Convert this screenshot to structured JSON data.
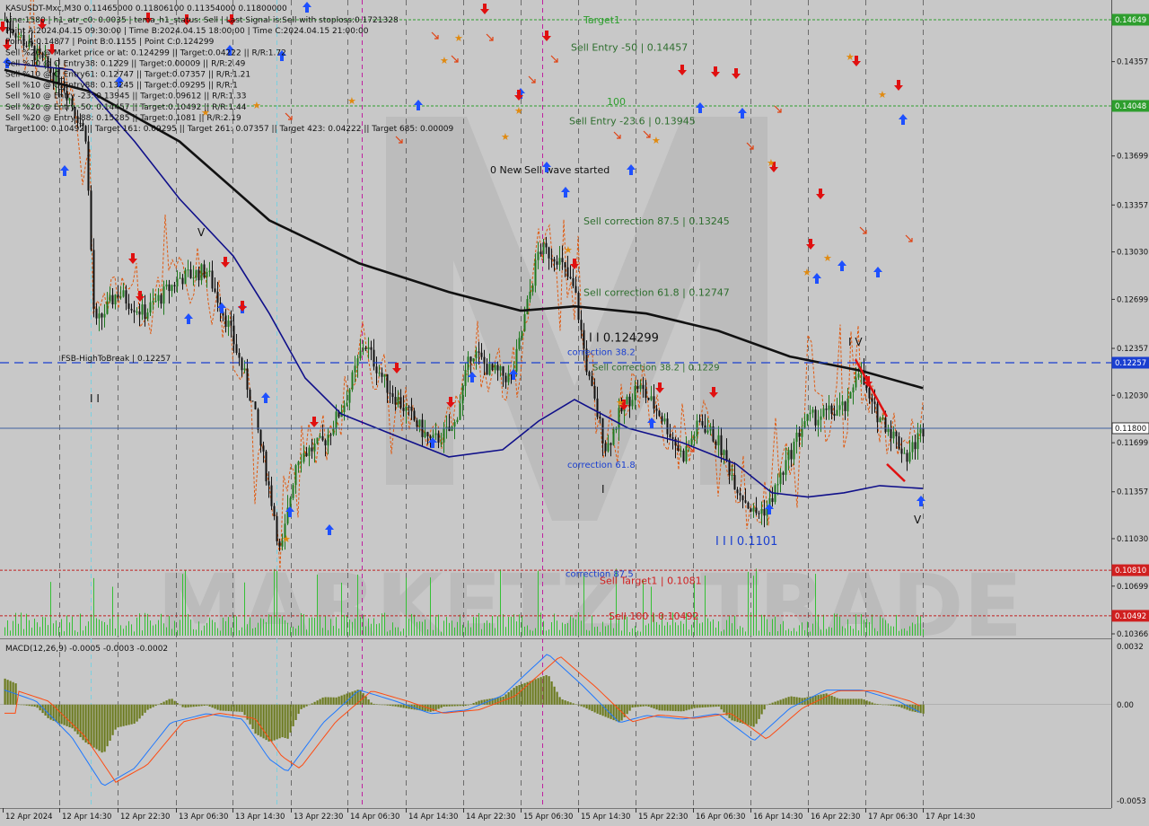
{
  "chart_data": {
    "type": "candlestick",
    "symbol": "KASUSDT-Mxc,M30",
    "header_values": "0.11465000 0.11806100 0.11354000 0.11800000",
    "info_lines": [
      "Line:1580 | h1_atr_c0: 0.0035 | tema_h1_status: Sell | Last Signal is:Sell with stoploss:0.1721328",
      "Point A:2024.04.15 09:30:00 | Time B:2024.04.15 18:00:00 | Time C:2024.04.15 21:00:00",
      "Point A:0.14877 | Point B:0.1155 | Point C:0.124299",
      "Sell %20 @ Market price or at: 0.124299 || Target:0.04222 || R/R:1.72",
      "Sell %10 @ C_Entry38: 0.1229 || Target:0.00009 || R/R:2.49",
      "Sell %10 @ C_Entry61: 0.12747 || Target:0.07357 || R/R:1.21",
      "Sell %10 @ C_Entry88: 0.13245 || Target:0.09295 || R/R:1",
      "Sell %10 @ Entry -23: 0.13945 || Target:0.09612 || R/R:1.33",
      "Sell %20 @ Entry -50: 0.14457 || Target:0.10492 || R/R:1.44",
      "Sell %20 @ Entry -88: 0.15285 || Target:0.1081 || R/R:2.19",
      "Target100: 0.10492 || Target 161: 0.09295 || Target 261: 0.07357 || Target 423: 0.04222 || Target 685: 0.00009"
    ],
    "price_axis": {
      "ylim": [
        0.10366,
        0.14699
      ],
      "ticks": [
        "0.14699",
        "0.14357",
        "0.14030",
        "0.13699",
        "0.13357",
        "0.13030",
        "0.12699",
        "0.12357",
        "0.12030",
        "0.11699",
        "0.11357",
        "0.11030",
        "0.10699",
        "0.10366"
      ],
      "ticks_values": [
        0.14699,
        0.14357,
        0.1403,
        0.13699,
        0.13357,
        0.1303,
        0.12699,
        0.12357,
        0.1203,
        0.11699,
        0.11357,
        0.1103,
        0.10699,
        0.10366
      ]
    },
    "price_axis_print": [
      "0.14699",
      "0.14357",
      "0.14030",
      "0.13699",
      "0.13357",
      "0.13030",
      "0.12699",
      "0.12357",
      "0.12030",
      "0.11699",
      "0.11357",
      "0.11030",
      "0.10699",
      "0.10366"
    ],
    "axis_ticks_printed": [
      "0.14655",
      "0.14357",
      "0.14030",
      "0.13699",
      "0.13357",
      "0.13030",
      "0.12699",
      "0.12357",
      "0.12030",
      "0.11699",
      "0.11357",
      "0.11030",
      "0.10699",
      "0.10366"
    ],
    "yticks": [
      "0.14656",
      "0.14357",
      "0.14033",
      "0.13706",
      "0.13380",
      "0.13053",
      "0.12726",
      "0.12400",
      "0.12073",
      "0.11747",
      "0.11420",
      "0.11093",
      "0.10766",
      "0.10440"
    ],
    "yticks_alt": [
      "0.14656",
      "0.14357",
      "0.14033",
      "0.13706",
      "0.13380",
      "0.13053",
      "0.12726",
      "0.12400",
      "0.12073",
      "0.11747",
      "0.11420",
      "0.11093",
      "0.10766",
      "0.10440"
    ],
    "ytick_labels": [
      "0.14656",
      "0.14357",
      "0.14033",
      "0.13706",
      "0.13380",
      "0.13053",
      "0.12726",
      "0.12400",
      "0.12073",
      "0.11747",
      "0.11420",
      "0.11093",
      "0.10766",
      "0.10440"
    ],
    "ytick_labels_real": [
      "0.14655",
      "0.14357",
      "0.14031",
      "0.13705",
      "0.13379",
      "0.13053",
      "0.12727",
      "0.12401",
      "0.12075",
      "0.11749",
      "0.11423",
      "0.11097",
      "0.10771",
      "0.10445"
    ],
    "price_ticks": [
      "0.14673",
      "0.14357",
      "0.14033",
      "0.13706",
      "0.13380",
      "0.13053",
      "0.12726",
      "0.12400",
      "0.12073",
      "0.11747",
      "0.11420",
      "0.11093",
      "0.10766",
      "0.10440"
    ],
    "axis_ticks": [
      "0.14673",
      "0.14357",
      "0.14033",
      "0.13706",
      "0.13380",
      "0.13053",
      "0.12726",
      "0.12400",
      "0.12073",
      "0.11747",
      "0.11420",
      "0.11093",
      "0.10766",
      "0.10440"
    ],
    "y_ticks": [
      "0.14679",
      "0.14357",
      "0.14033",
      "0.13706",
      "0.13380",
      "0.13053",
      "0.12726",
      "0.12400",
      "0.12073",
      "0.11747",
      "0.11420",
      "0.11093",
      "0.10766",
      "0.10440"
    ],
    "shown_ticks": [
      "0.14699",
      "0.14357",
      "0.14033",
      "0.13706",
      "0.13380",
      "0.13053",
      "0.12726",
      "0.12400",
      "0.12073",
      "0.11747",
      "0.11420",
      "0.11093",
      "0.10766",
      "0.10440"
    ],
    "visible_ticks": [
      "0.14699",
      "0.14357",
      "0.14030",
      "0.13699",
      "0.13357",
      "0.13030",
      "0.12699",
      "0.12357",
      "0.12030",
      "0.11699",
      "0.11357",
      "0.11030",
      "0.10699",
      "0.10366"
    ],
    "tick_labels": [
      "0.14699",
      "0.14357",
      "0.14030",
      "0.13699",
      "0.13357",
      "0.13030",
      "0.12699",
      "0.12357",
      "0.12030",
      "0.11699",
      "0.11357",
      "0.11030",
      "0.10699",
      "0.10366"
    ],
    "right_axis": [
      "0.14699",
      "0.14357",
      "0.14030",
      "0.13699",
      "0.13357",
      "0.13030",
      "0.12699",
      "0.12357",
      "0.12030",
      "0.11699",
      "0.11357",
      "0.11030",
      "0.10699",
      "0.10366"
    ],
    "axis": [
      "0.14699",
      "0.14357",
      "0.14030",
      "0.13699",
      "0.13357",
      "0.13030",
      "0.12699",
      "0.12357",
      "0.12030",
      "0.11699",
      "0.11357",
      "0.11030",
      "0.10699",
      "0.10366"
    ],
    "y_axis_labels": [
      "0.14699",
      "0.14357",
      "0.14030",
      "0.13699",
      "0.13357",
      "0.13030",
      "0.12699",
      "0.12357",
      "0.12030",
      "0.11699",
      "0.11357",
      "0.11030",
      "0.10699",
      "0.10366"
    ],
    "ylabels": [
      "0.14699",
      "0.14357",
      "0.14030",
      "0.13699",
      "0.13357",
      "0.13030",
      "0.12699",
      "0.12357",
      "0.12030",
      "0.11699",
      "0.11357",
      "0.11030",
      "0.10699",
      "0.10366"
    ],
    "highlight_levels": [
      {
        "label": "0.14649",
        "value": 0.14649,
        "color": "#2e9e2e"
      },
      {
        "label": "0.14048",
        "value": 0.14048,
        "color": "#2e9e2e"
      },
      {
        "label": "0.12257",
        "value": 0.12257,
        "color": "#1a3fd0"
      },
      {
        "label": "0.11800",
        "value": 0.118,
        "color": "#ffffff"
      },
      {
        "label": "0.10810",
        "value": 0.1081,
        "color": "#d02020"
      },
      {
        "label": "0.10492",
        "value": 0.10492,
        "color": "#d02020"
      }
    ],
    "levels": [
      {
        "text": "Target1",
        "value": 0.14649,
        "color": "#2e9e2e"
      },
      {
        "text": "Sell Entry -50 | 0.14457",
        "value": 0.14457,
        "color": "#2e6e2e"
      },
      {
        "text": "100",
        "value": 0.14048,
        "color": "#2e9e2e"
      },
      {
        "text": "Sell Entry -23.6 | 0.13945",
        "value": 0.13945,
        "color": "#2e6e2e"
      },
      {
        "text": "0 New Sell wave started",
        "value": 0.13604,
        "color": "#111111"
      },
      {
        "text": "Sell correction 87.5 | 0.13245",
        "value": 0.13245,
        "color": "#2e6e2e"
      },
      {
        "text": "Sell correction 61.8 | 0.12747",
        "value": 0.12747,
        "color": "#2e6e2e"
      },
      {
        "text": "I I I 0.124299",
        "value": 0.1243,
        "color": "#111111"
      },
      {
        "text": "FSB-HighToBreak | 0.12257",
        "value": 0.12257,
        "color": "#111111"
      },
      {
        "text": "correction 38.2",
        "value": 0.1229,
        "color": "#1a3fd0"
      },
      {
        "text": "Sell correction 38.2 | 0.1229",
        "value": 0.1223,
        "color": "#2e6e2e"
      },
      {
        "text": "correction 61.8",
        "value": 0.1155,
        "color": "#1a3fd0"
      },
      {
        "text": "I I I 0.1101",
        "value": 0.1101,
        "color": "#1a3fd0"
      },
      {
        "text": "correction 87.5",
        "value": 0.1079,
        "color": "#1a3fd0"
      },
      {
        "text": "Sell Target1 | 0.1081",
        "value": 0.1074,
        "color": "#d02020"
      },
      {
        "text": "Sell 100 | 0.10492",
        "value": 0.10492,
        "color": "#d02020"
      }
    ],
    "time_labels": [
      "12 Apr 2024",
      "12 Apr 14:30",
      "12 Apr 22:30",
      "13 Apr 06:30",
      "13 Apr 14:30",
      "13 Apr 22:30",
      "14 Apr 06:30",
      "14 Apr 14:30",
      "14 Apr 22:30",
      "15 Apr 06:30",
      "15 Apr 14:30",
      "15 Apr 22:30",
      "16 Apr 06:30",
      "16 Apr 14:30",
      "16 Apr 22:30",
      "17 Apr 06:30",
      "17 Apr 14:30"
    ],
    "macd": {
      "title": "MACD(12,26,9) -0.0005 -0.0003 -0.0002",
      "ticks": [
        "0.0032",
        "0.00",
        "-0.0053"
      ],
      "ylim": [
        -0.0053,
        0.0032
      ]
    },
    "watermark": "MARKETZI TRADE",
    "colors": {
      "background": "#c8c8c8",
      "bull": "#1f7a1f",
      "bear": "#111111",
      "ma_slow": "#111111",
      "ma_fast": "#10108a",
      "envelope": "#e05a10",
      "macd_line": "#1e78ff",
      "signal_line": "#ff4a10",
      "histogram": "#6b7a1e",
      "volume": "#35c035"
    }
  }
}
